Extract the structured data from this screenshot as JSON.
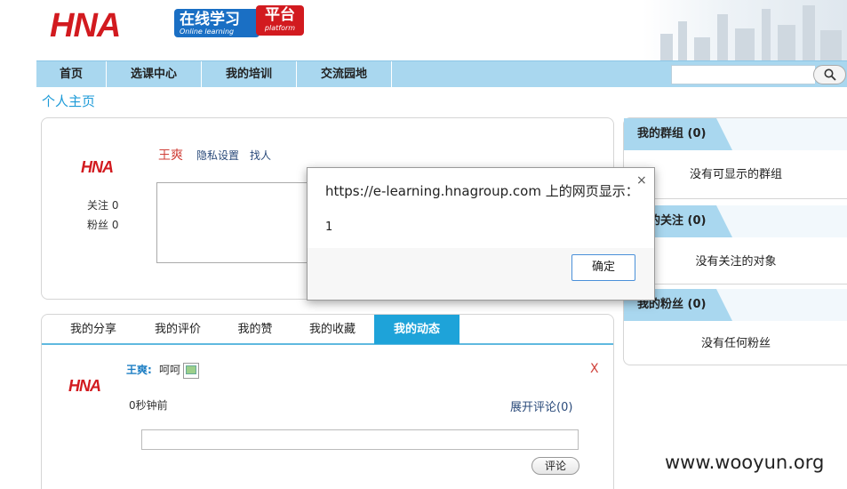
{
  "header": {
    "logo_text": "HNA",
    "badge_zh": "在线学习",
    "badge_en": "Online learning",
    "badge2_zh": "平台",
    "badge2_en": "platform"
  },
  "nav": {
    "items": [
      {
        "label": "首页"
      },
      {
        "label": "选课中心"
      },
      {
        "label": "我的培训"
      },
      {
        "label": "交流园地"
      }
    ],
    "search_placeholder": ""
  },
  "page_title": "个人主页",
  "profile": {
    "logo_text": "HNA",
    "following_label": "关注 0",
    "fans_label": "粉丝 0",
    "user_name": "王爽",
    "privacy_link": "隐私设置",
    "find_people_link": "找人"
  },
  "tabs": {
    "items": [
      {
        "label": "我的分享"
      },
      {
        "label": "我的评价"
      },
      {
        "label": "我的赞"
      },
      {
        "label": "我的收藏"
      },
      {
        "label": "我的动态"
      }
    ],
    "active_index": 4
  },
  "feed": {
    "logo_text": "HNA",
    "author": "王爽:",
    "text": "呵呵",
    "delete_label": "X",
    "time": "0秒钟前",
    "expand_comments": "展开评论(0)",
    "comment_button": "评论"
  },
  "sidebar": {
    "groups_title": "我的群组 (0)",
    "groups_empty": "没有可显示的群组",
    "following_title": "我的关注 (0)",
    "following_empty": "没有关注的对象",
    "fans_title": "我的粉丝 (0)",
    "fans_empty": "没有任何粉丝"
  },
  "dialog": {
    "title": "https://e-learning.hnagroup.com 上的网页显示：",
    "close": "×",
    "message": "1",
    "ok_label": "确定"
  },
  "watermark": "www.wooyun.org",
  "colors": {
    "nav_bg": "#a9d7ef",
    "accent_blue": "#1ea3d9",
    "brand_red": "#d21a1f",
    "brand_orange": "#f2a400"
  }
}
